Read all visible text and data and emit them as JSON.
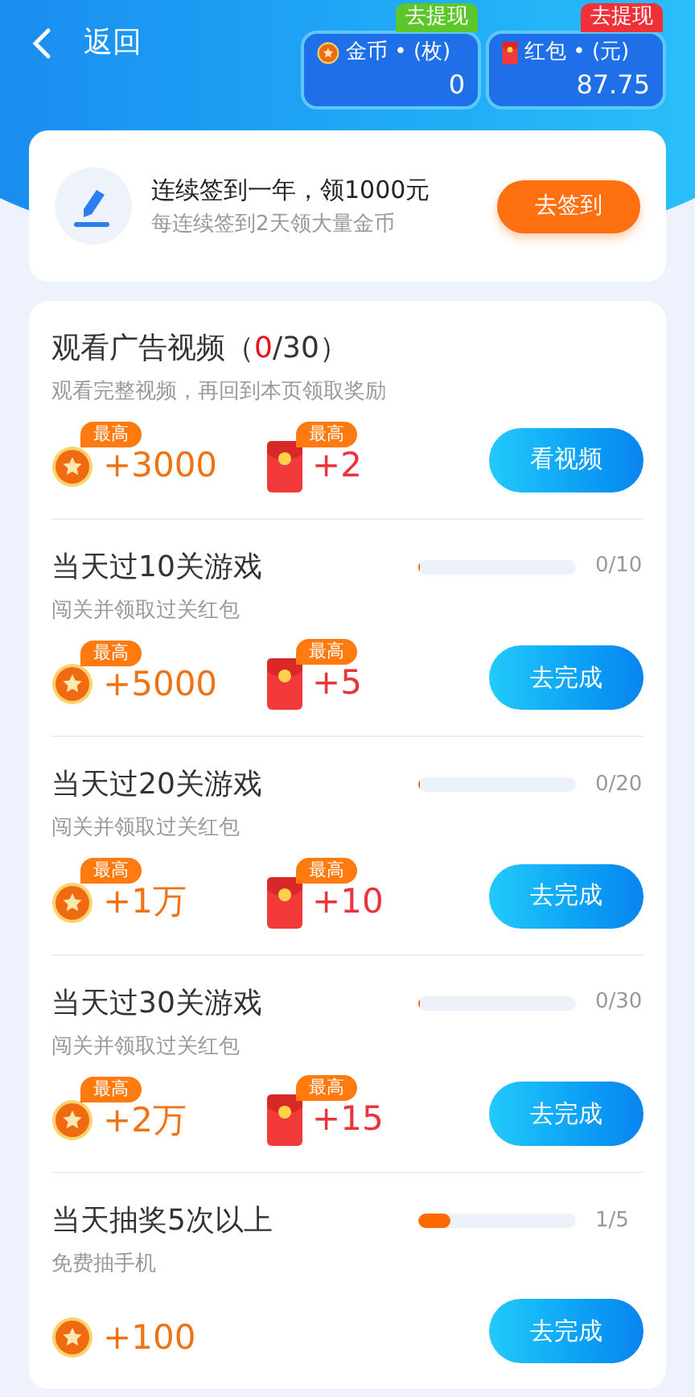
{
  "header": {
    "back": "返回"
  },
  "wallets": [
    {
      "kind": "coin",
      "tag": "去提现",
      "color": "#5cc62b",
      "label": "金币",
      "dot": "•",
      "unit": "(枚)",
      "value": "0"
    },
    {
      "kind": "redpacket",
      "tag": "去提现",
      "color": "#f0313a",
      "label": "红包",
      "dot": "•",
      "unit": "(元)",
      "value": "87.75"
    }
  ],
  "checkin": {
    "title": "连续签到一年，领1000元",
    "subtitle": "每连续签到2天领大量金币",
    "button": "去签到"
  },
  "tasks": [
    {
      "title": "观看广告视频（",
      "done": "0",
      "total": "/30）",
      "subtitle": "观看完整视频，再回到本页领取奖励",
      "rewards": [
        {
          "kind": "coin",
          "badge": "最高",
          "amount": "+3000"
        },
        {
          "kind": "redpacket",
          "badge": "最高",
          "amount": "+2"
        }
      ],
      "button": "看视频"
    },
    {
      "title": "当天过10关游戏",
      "progress": {
        "level": 0,
        "reading": "0/10"
      },
      "subtitle": "闯关并领取过关红包",
      "rewards": [
        {
          "kind": "coin",
          "badge": "最高",
          "amount": "+5000"
        },
        {
          "kind": "redpacket",
          "badge": "最高",
          "amount": "+5"
        }
      ],
      "button": "去完成"
    },
    {
      "title": "当天过20关游戏",
      "progress": {
        "level": 0,
        "reading": "0/20"
      },
      "subtitle": "闯关并领取过关红包",
      "rewards": [
        {
          "kind": "coin",
          "badge": "最高",
          "amount": "+1万"
        },
        {
          "kind": "redpacket",
          "badge": "最高",
          "amount": "+10"
        }
      ],
      "button": "去完成"
    },
    {
      "title": "当天过30关游戏",
      "progress": {
        "level": 0,
        "reading": "0/30"
      },
      "subtitle": "闯关并领取过关红包",
      "rewards": [
        {
          "kind": "coin",
          "badge": "最高",
          "amount": "+2万"
        },
        {
          "kind": "redpacket",
          "badge": "最高",
          "amount": "+15"
        }
      ],
      "button": "去完成"
    },
    {
      "title": "当天抽奖5次以上",
      "progress": {
        "level": 0.2,
        "reading": "1/5"
      },
      "subtitle": "免费抽手机",
      "rewards": [
        {
          "kind": "coin",
          "amount": "+100"
        }
      ],
      "button": "去完成"
    }
  ]
}
